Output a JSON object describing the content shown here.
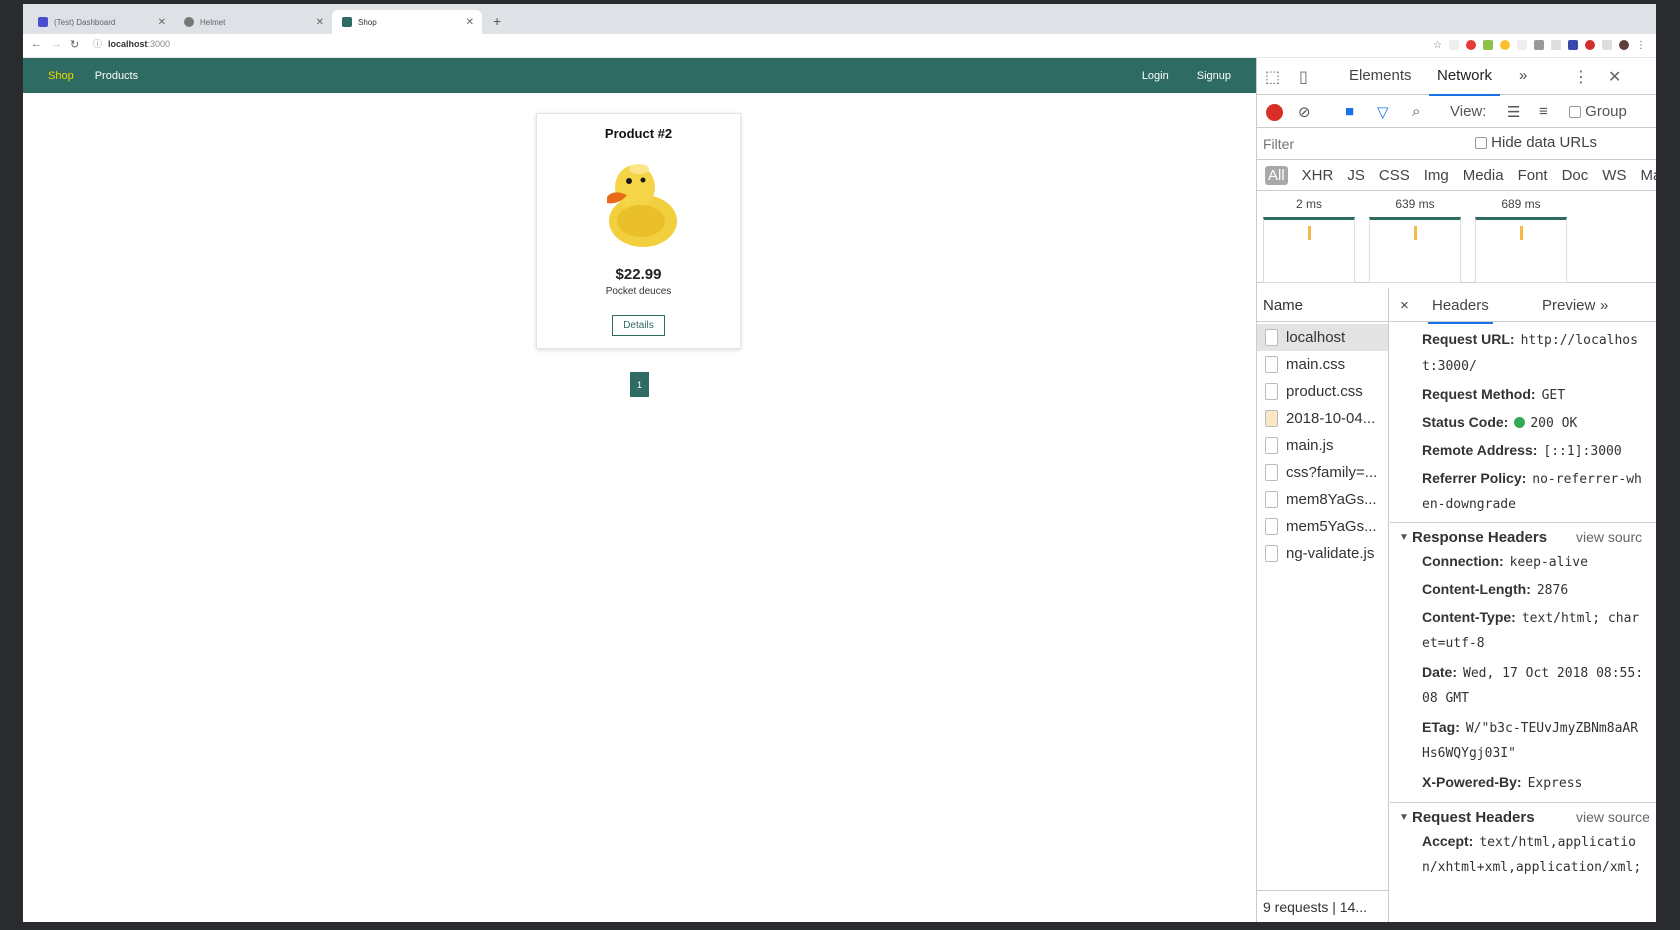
{
  "browser": {
    "tabs": [
      {
        "title": "(Test) Dashboard",
        "active": false
      },
      {
        "title": "Helmet",
        "active": false
      },
      {
        "title": "Shop",
        "active": true
      }
    ],
    "address": {
      "host": "localhost",
      "port": ":3000"
    }
  },
  "shop": {
    "nav": {
      "shop": "Shop",
      "products": "Products",
      "login": "Login",
      "signup": "Signup"
    },
    "product": {
      "title": "Product #2",
      "image_alt": "rubber duck",
      "price": "$22.99",
      "description": "Pocket deuces",
      "details_label": "Details"
    },
    "page": "1"
  },
  "devtools": {
    "tabs": {
      "elements": "Elements",
      "network": "Network",
      "more": "»"
    },
    "toolbar": {
      "view_label": "View:",
      "group_label": "Group"
    },
    "filter": {
      "placeholder": "Filter",
      "hide_data_urls": "Hide data URLs"
    },
    "types": [
      "All",
      "XHR",
      "JS",
      "CSS",
      "Img",
      "Media",
      "Font",
      "Doc",
      "WS",
      "Man"
    ],
    "filmstrip": [
      "2 ms",
      "639 ms",
      "689 ms"
    ],
    "name_header": "Name",
    "requests": [
      {
        "name": "localhost",
        "selected": true,
        "kind": "doc"
      },
      {
        "name": "main.css",
        "selected": false,
        "kind": "doc"
      },
      {
        "name": "product.css",
        "selected": false,
        "kind": "doc"
      },
      {
        "name": "2018-10-04...",
        "selected": false,
        "kind": "img"
      },
      {
        "name": "main.js",
        "selected": false,
        "kind": "doc"
      },
      {
        "name": "css?family=...",
        "selected": false,
        "kind": "doc"
      },
      {
        "name": "mem8YaGs...",
        "selected": false,
        "kind": "doc"
      },
      {
        "name": "mem5YaGs...",
        "selected": false,
        "kind": "doc"
      },
      {
        "name": "ng-validate.js",
        "selected": false,
        "kind": "doc"
      }
    ],
    "footer": "9 requests | 14...",
    "detail_tabs": {
      "close": "×",
      "headers": "Headers",
      "preview": "Preview",
      "more": "»"
    },
    "general": {
      "request_url_label": "Request URL:",
      "request_url_1": "http://localhos",
      "request_url_2": "t:3000/",
      "method_label": "Request Method:",
      "method": "GET",
      "status_label": "Status Code:",
      "status": "200 OK",
      "remote_label": "Remote Address:",
      "remote": "[::1]:3000",
      "referrer_label": "Referrer Policy:",
      "referrer_1": "no-referrer-wh",
      "referrer_2": "en-downgrade"
    },
    "response": {
      "title": "Response Headers",
      "view_source": "view sourc",
      "connection_label": "Connection:",
      "connection": "keep-alive",
      "length_label": "Content-Length:",
      "length": "2876",
      "type_label": "Content-Type:",
      "type_1": "text/html; char",
      "type_2": "et=utf-8",
      "date_label": "Date:",
      "date_1": "Wed, 17 Oct 2018 08:55:",
      "date_2": "08 GMT",
      "etag_label": "ETag:",
      "etag_1": "W/\"b3c-TEUvJmyZBNm8aAR",
      "etag_2": "Hs6WQYgj03I\"",
      "powered_label": "X-Powered-By:",
      "powered": "Express"
    },
    "request": {
      "title": "Request Headers",
      "view_source": "view source",
      "accept_label": "Accept:",
      "accept_1": "text/html,applicatio",
      "accept_2": "n/xhtml+xml,application/xml;"
    }
  }
}
